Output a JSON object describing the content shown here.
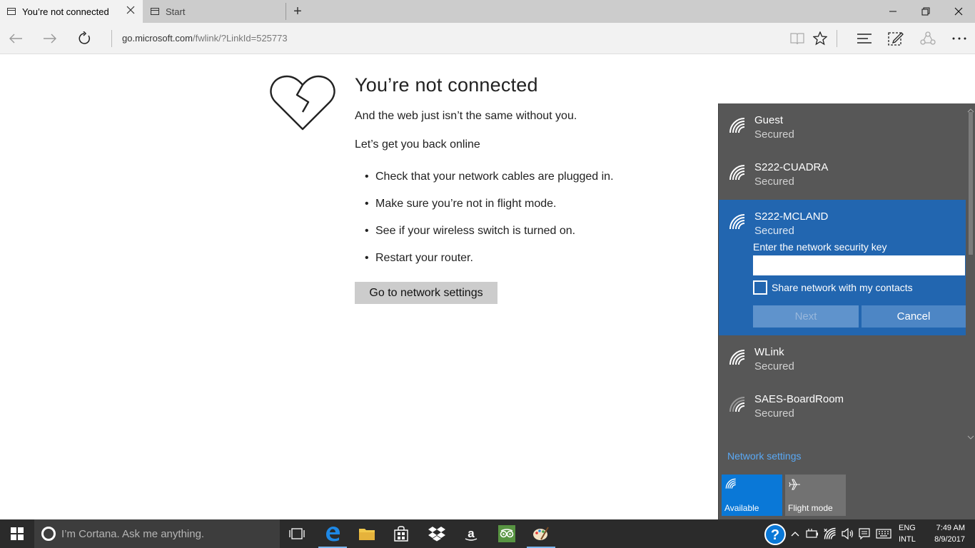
{
  "browser": {
    "tabs": [
      {
        "label": "You’re not connected",
        "active": true
      },
      {
        "label": "Start",
        "active": false
      }
    ],
    "url": {
      "domain": "go.microsoft.com",
      "path": "/fwlink/?LinkId=525773"
    }
  },
  "error_page": {
    "title": "You’re not connected",
    "subtitle": "And the web just isn’t the same without you.",
    "lead": "Let’s get you back online",
    "tips": [
      "Check that your network cables are plugged in.",
      "Make sure you’re not in flight mode.",
      "See if your wireless switch is turned on.",
      "Restart your router."
    ],
    "button": "Go to network settings"
  },
  "network_flyout": {
    "networks": [
      {
        "ssid": "Guest",
        "status": "Secured"
      },
      {
        "ssid": "S222-CUADRA",
        "status": "Secured"
      },
      {
        "ssid": "S222-MCLAND",
        "status": "Secured"
      },
      {
        "ssid": "WLink",
        "status": "Secured"
      },
      {
        "ssid": "SAES-BoardRoom",
        "status": "Secured"
      }
    ],
    "selected": {
      "key_label": "Enter the network security key",
      "key_value": "",
      "share_label": "Share network with my contacts",
      "share_checked": false,
      "next_label": "Next",
      "cancel_label": "Cancel"
    },
    "settings_link": "Network settings",
    "quick_actions": [
      {
        "label": "Available",
        "icon": "wifi-icon",
        "active": true
      },
      {
        "label": "Flight mode",
        "icon": "airplane-icon",
        "active": false
      }
    ],
    "colors": {
      "flyout_bg": "#575757",
      "selected_bg": "#2266b0",
      "accent": "#0a78d7",
      "link": "#5aa9f5"
    }
  },
  "taskbar": {
    "search_placeholder": "I’m Cortana. Ask me anything.",
    "apps": [
      "task-view-icon",
      "edge-icon",
      "file-explorer-icon",
      "store-icon",
      "dropbox-icon",
      "amazon-icon",
      "tripadvisor-icon",
      "paint-icon"
    ],
    "language": {
      "line1": "ENG",
      "line2": "INTL"
    },
    "clock": {
      "time": "7:49 AM",
      "date": "8/9/2017"
    }
  }
}
